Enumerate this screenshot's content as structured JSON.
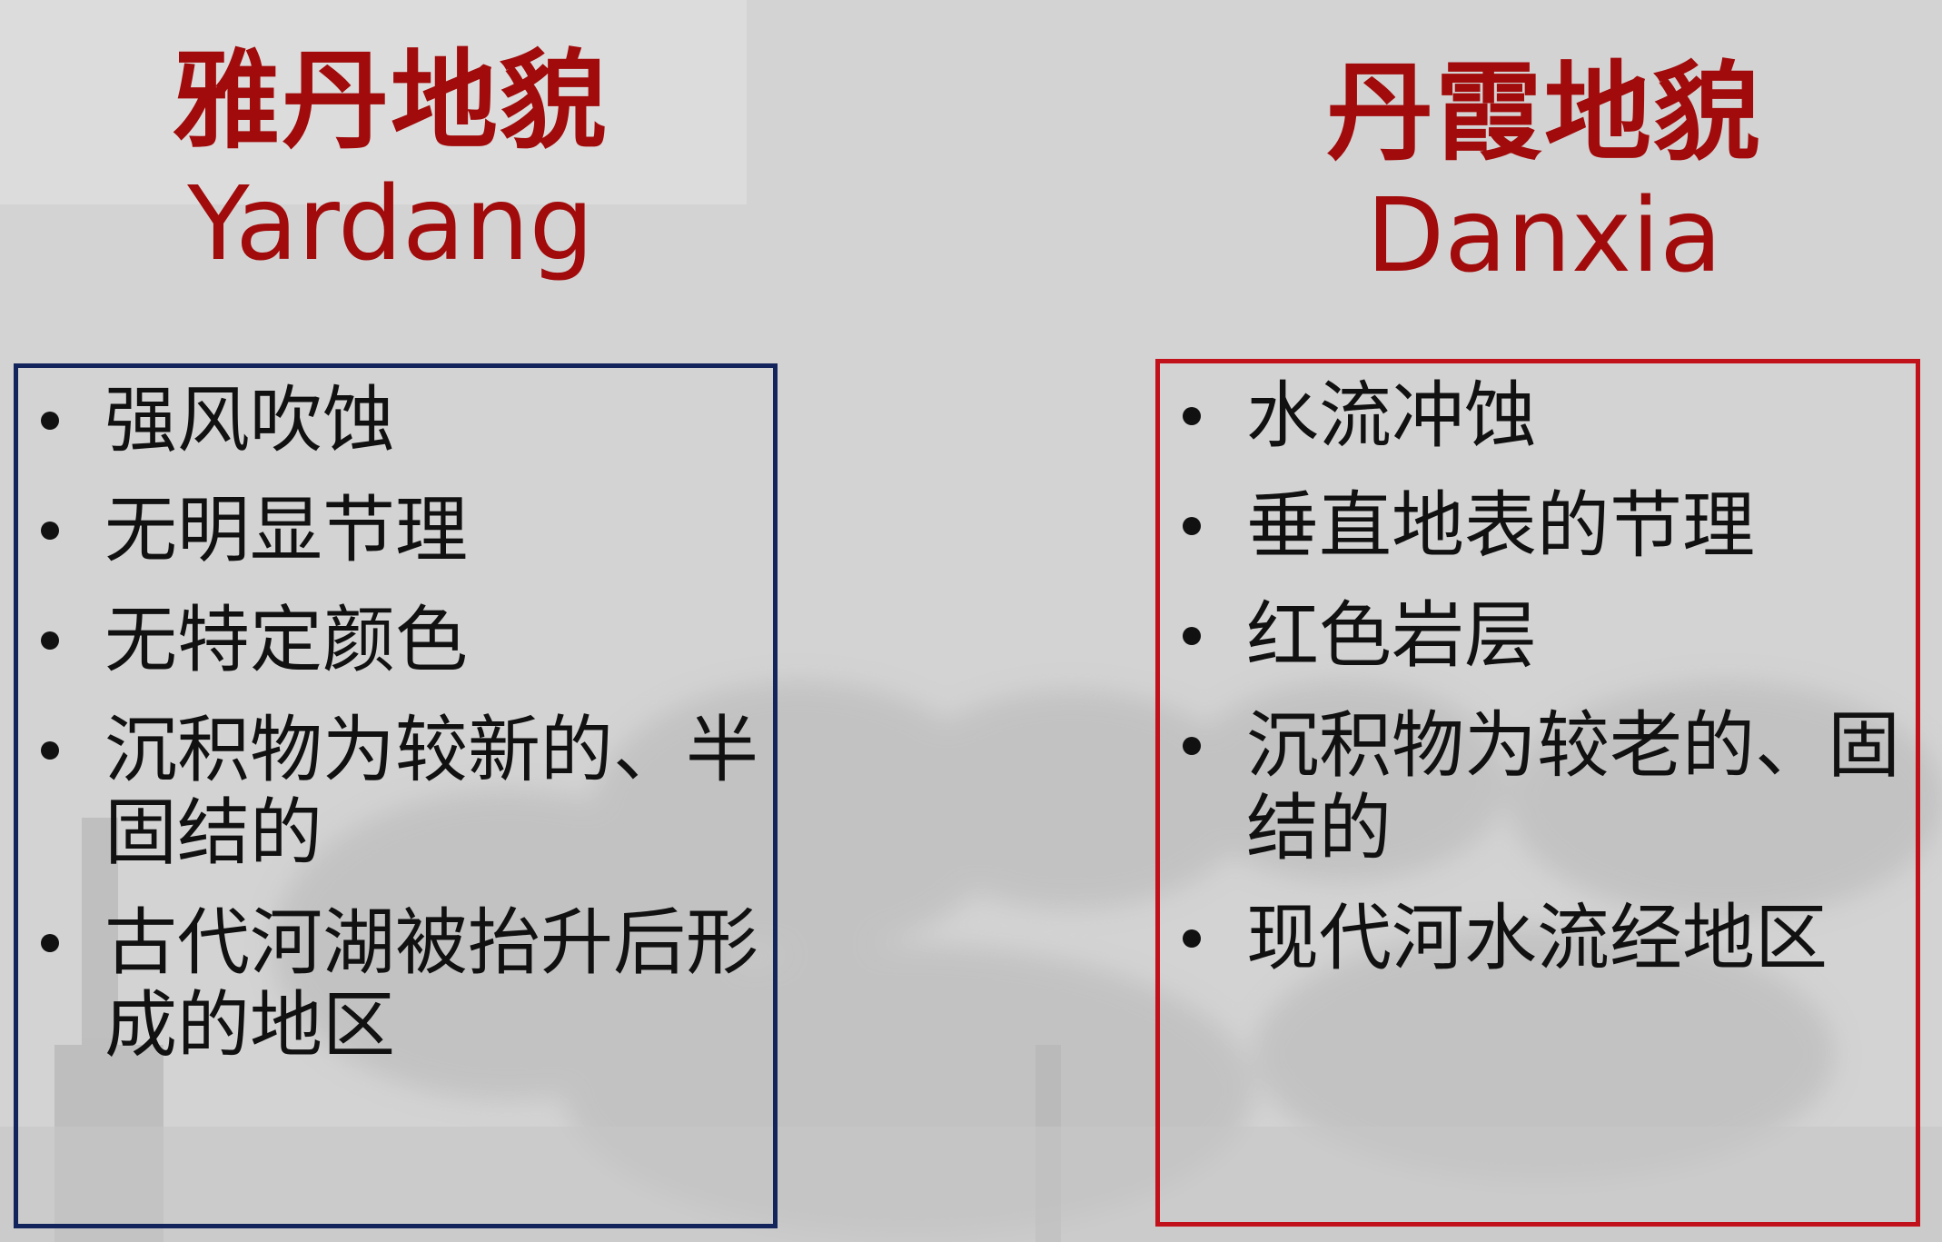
{
  "colors": {
    "background": "#d3d3d3",
    "title": "#a10b0b",
    "left_border": "#13235b",
    "right_border": "#c1111a",
    "text": "#111111"
  },
  "left": {
    "title_zh": "雅丹地貌",
    "title_en": "Yardang",
    "items": [
      "强风吹蚀",
      "无明显节理",
      "无特定颜色",
      "沉积物为较新的、半固结的",
      "古代河湖被抬升后形成的地区"
    ]
  },
  "right": {
    "title_zh": "丹霞地貌",
    "title_en": "Danxia",
    "items": [
      "水流冲蚀",
      "垂直地表的节理",
      "红色岩层",
      "沉积物为较老的、固结的",
      "现代河水流经地区"
    ]
  }
}
